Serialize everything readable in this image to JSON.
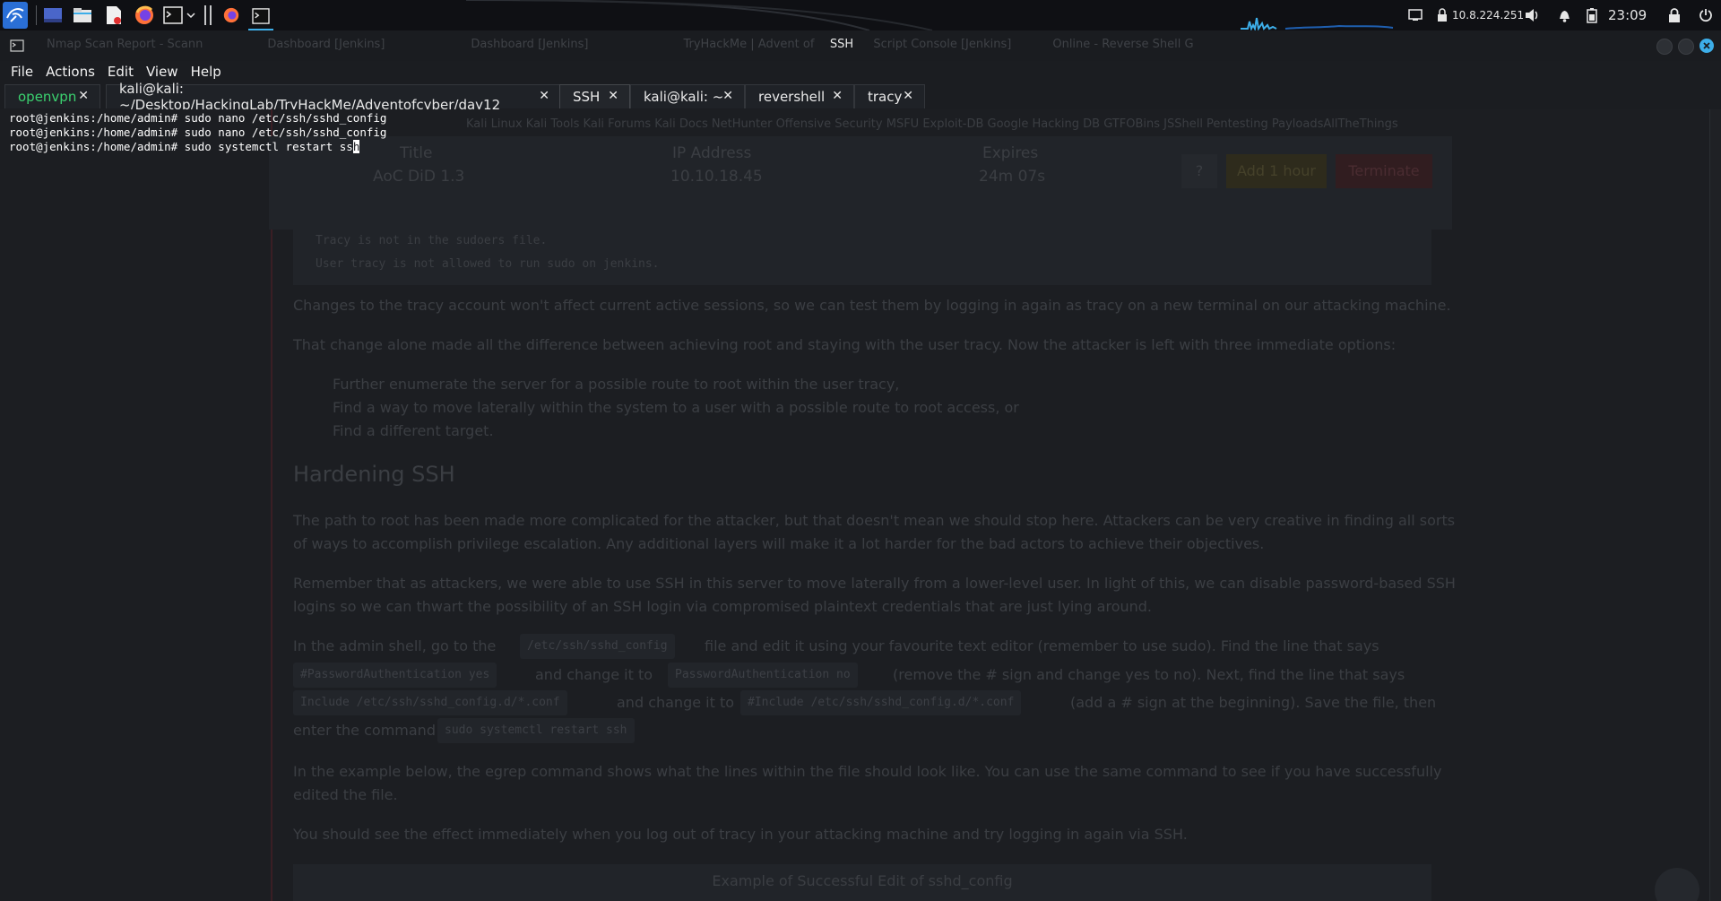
{
  "taskbar": {
    "network": {
      "ip": "10.8.224.251"
    },
    "clock": "23:09"
  },
  "window": {
    "title": "SSH",
    "background_tabs": [
      "Nmap Scan Report - Scann",
      "Dashboard [Jenkins]",
      "Dashboard [Jenkins]",
      "TryHackMe | Advent of",
      "Script Console [Jenkins]",
      "Online - Reverse Shell G"
    ]
  },
  "menu": [
    "File",
    "Actions",
    "Edit",
    "View",
    "Help"
  ],
  "tabs": [
    {
      "label": "openvpn",
      "active": false
    },
    {
      "label": "kali@kali: ~/Desktop/HackingLab/TryHackMe/Adventofcyber/day12",
      "active": false
    },
    {
      "label": "SSH",
      "active": true
    },
    {
      "label": "kali@kali: ~",
      "active": false
    },
    {
      "label": "revershell",
      "active": false
    },
    {
      "label": "tracy",
      "active": false
    }
  ],
  "terminal": {
    "lines": [
      "root@jenkins:/home/admin# sudo nano /etc/ssh/sshd_config",
      "root@jenkins:/home/admin# sudo nano /etc/ssh/sshd_config",
      "root@jenkins:/home/admin# sudo systemctl restart ss"
    ],
    "cursor_char": "h"
  },
  "background_page": {
    "machine_table": {
      "headers": [
        "Title",
        "IP Address",
        "Expires"
      ],
      "values": [
        "AoC DiD 1.3",
        "10.10.18.45",
        "24m 07s"
      ],
      "buttons": [
        "?",
        "Add 1 hour",
        "Terminate"
      ]
    },
    "bookmarks": "Kali Linux   Kali Tools   Kali Forums   Kali Docs   NetHunter   Offensive Security   MSFU   Exploit-DB   Google Hacking DB   GTFOBins   JSShell   Pentesting   PayloadsAllTheThings",
    "code_lines": [
      "Tracy is not in the sudoers file.",
      "User tracy is not allowed to run sudo on jenkins."
    ],
    "para1": "Changes to the tracy account won't affect current active sessions, so we can test them by logging in again as tracy on a new terminal on our attacking machine.",
    "para2": "That change alone made all the difference between achieving root and staying with the user tracy. Now the attacker is left with three immediate options:",
    "bullets": [
      "Further enumerate the server for a possible route to root within the user tracy,",
      "Find a way to move laterally within the system to a user with a possible route to root access, or",
      "Find a different target."
    ],
    "heading": "Hardening SSH",
    "para3a": "The path to root has been made more complicated for the attacker, but that doesn't mean we should stop here. Attackers can be very creative in finding all sorts",
    "para3b": "of ways to accomplish privilege escalation. Any additional layers will make it a lot harder for the bad actors to achieve their objectives.",
    "para4a": "Remember that as attackers, we were able to use SSH in this server to move laterally from a lower-level user. In light of this, we can disable password-based SSH",
    "para4b": "logins so we can thwart the possibility of an SSH login via compromised plaintext credentials that are just lying around.",
    "para5": {
      "t1": "In the admin shell, go to the",
      "c1": "/etc/ssh/sshd_config",
      "t2": "file and edit it using your favourite text editor (remember to use sudo). Find the line that says",
      "c2": "#PasswordAuthentication yes",
      "t3": "and change it to",
      "c3": "PasswordAuthentication no",
      "t4": "(remove the # sign and change yes to no). Next, find the line that says",
      "c4": "Include /etc/ssh/sshd_config.d/*.conf",
      "t5": "and change it to",
      "c5": "#Include /etc/ssh/sshd_config.d/*.conf",
      "t6": "(add a # sign at the beginning). Save the file, then",
      "t7": "enter the command",
      "c6": "sudo systemctl restart ssh"
    },
    "para6a": "In the example below, the egrep command shows what the lines within the file should look like. You can use the same command to see if you have successfully",
    "para6b": "edited the file.",
    "para7": "You should see the effect immediately when you log out of tracy in your attacking machine and try logging in again via SSH.",
    "example_title": "Example of Successful Edit of sshd_config"
  },
  "colors": {
    "accent": "#3daee9",
    "active_tab_green": "#3bd16f",
    "terminal_bg": "#1b1d21"
  }
}
